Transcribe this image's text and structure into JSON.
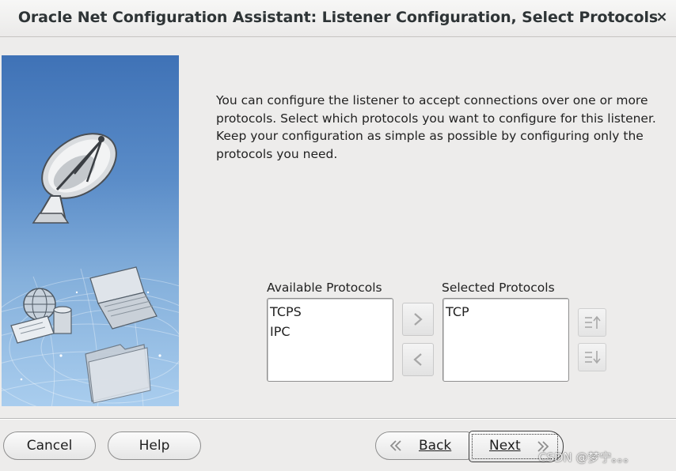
{
  "window": {
    "title": "Oracle Net Configuration Assistant: Listener Configuration, Select Protocols",
    "close_glyph": "×"
  },
  "description": "You can configure the listener to accept connections over one or more protocols. Select which protocols you want to configure for this listener. Keep your configuration as simple as possible by configuring only the protocols you need.",
  "available": {
    "label": "Available Protocols",
    "items": [
      "TCPS",
      "IPC"
    ]
  },
  "selected": {
    "label": "Selected Protocols",
    "items": [
      "TCP"
    ]
  },
  "buttons": {
    "cancel": "Cancel",
    "help": "Help",
    "back": "Back",
    "next": "Next"
  },
  "icons": {
    "add": "chevron-right-icon",
    "remove": "chevron-left-icon",
    "move_up": "move-up-icon",
    "move_down": "move-down-icon",
    "banner": "satellite-dish-illustration"
  },
  "watermark": "CSDN @梦宁。。。",
  "colors": {
    "window_bg": "#edeceb",
    "banner_top": "#3f72b6",
    "banner_bottom": "#a9cdee"
  }
}
